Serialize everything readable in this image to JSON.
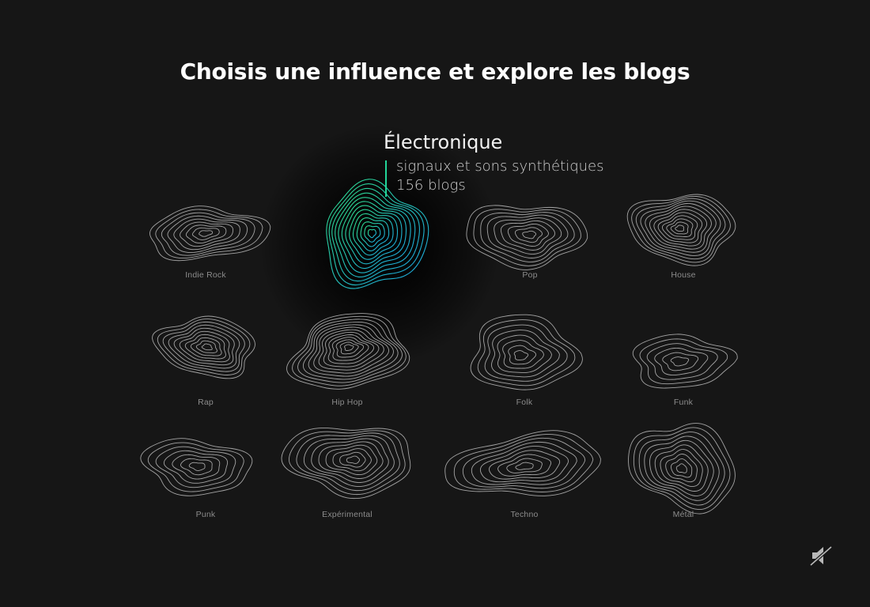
{
  "title": "Choisis une influence et explore les blogs",
  "tooltip": {
    "name": "Électronique",
    "description": "signaux et sons synthétiques",
    "count": "156 blogs",
    "accent_start": "#2fe08a",
    "accent_end": "#1aa3e6"
  },
  "genres": [
    {
      "id": "indie-rock",
      "label": "Indie Rock"
    },
    {
      "id": "electronique",
      "label": ""
    },
    {
      "id": "pop",
      "label": "Pop"
    },
    {
      "id": "house",
      "label": "House"
    },
    {
      "id": "rap",
      "label": "Rap"
    },
    {
      "id": "hip-hop",
      "label": "Hip Hop"
    },
    {
      "id": "folk",
      "label": "Folk"
    },
    {
      "id": "funk",
      "label": "Funk"
    },
    {
      "id": "punk",
      "label": "Punk"
    },
    {
      "id": "experimental",
      "label": "Expérimental"
    },
    {
      "id": "techno",
      "label": "Techno"
    },
    {
      "id": "metal",
      "label": "Métal"
    }
  ],
  "sound_icon": "sound-muted-icon",
  "colors": {
    "background": "#161616",
    "contour_stroke": "#bdbdbd",
    "label": "#8c8c8c"
  }
}
